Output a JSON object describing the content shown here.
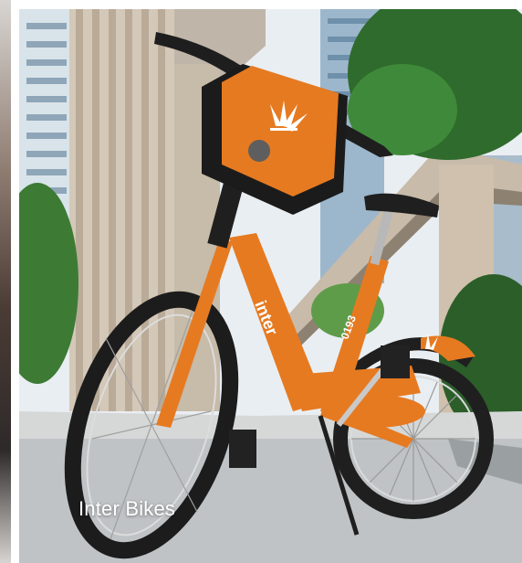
{
  "card": {
    "caption": "Inter Bikes",
    "bike_brand": "inter",
    "bike_number": "0193"
  },
  "colors": {
    "frame": "#e67a21",
    "tire": "#1f1f1f",
    "sky": "#e9eef2",
    "road": "#bfc3c5"
  }
}
